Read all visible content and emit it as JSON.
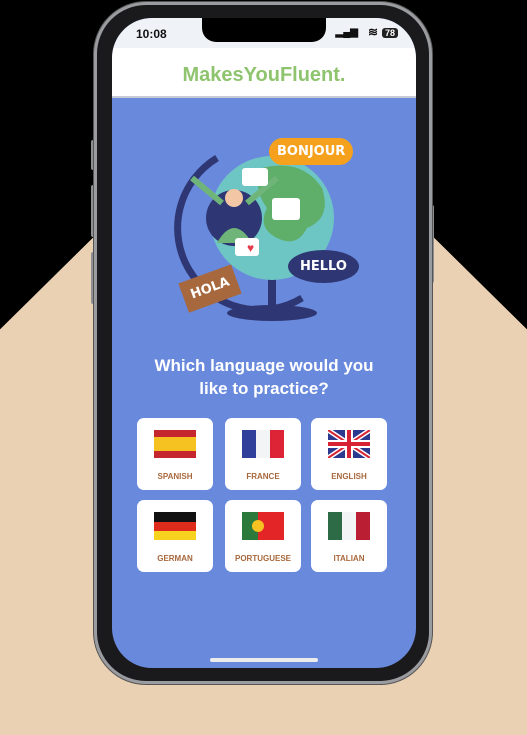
{
  "status": {
    "time": "10:08",
    "battery": "78"
  },
  "app": {
    "title": "MakesYouFluent."
  },
  "illustration": {
    "bubble_1": "BONJOUR",
    "bubble_2": "HELLO",
    "bubble_3": "HOLA"
  },
  "question": {
    "line1": "Which language would you",
    "line2": "like to practice?"
  },
  "languages": [
    {
      "label": "SPANISH"
    },
    {
      "label": "FRANCE"
    },
    {
      "label": "ENGLISH"
    },
    {
      "label": "GERMAN"
    },
    {
      "label": "PORTUGUESE"
    },
    {
      "label": "ITALIAN"
    }
  ],
  "colors": {
    "background": "#6989dc",
    "brand": "#8fc46f",
    "label": "#a8683d"
  }
}
